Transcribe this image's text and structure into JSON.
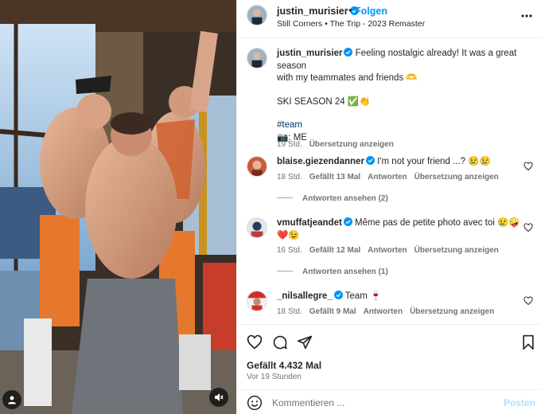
{
  "post": {
    "author": "justin_murisier",
    "separator": "•",
    "follow_label": "Folgen",
    "music": "Still Corners • The Trip - 2023 Remaster",
    "caption_lines": [
      "Feeling nostalgic already! It was a great season",
      "with my teammates and friends 🫶",
      "SKI SEASON 24 ✅👏",
      "#team",
      "📷: ME"
    ],
    "caption_time": "19 Std.",
    "translate_label": "Übersetzung anzeigen"
  },
  "comments": [
    {
      "username": "blaise.giezendanner",
      "text": "I'm not your friend ...? 😢😢",
      "time": "18 Std.",
      "likes": "Gefällt 13 Mal",
      "reply_label": "Antworten",
      "translate_label": "Übersetzung anzeigen",
      "view_replies": "Antworten ansehen (2)"
    },
    {
      "username": "vmuffatjeandet",
      "text": "Même pas de petite photo avec toi 😢🤪",
      "text2": "❤️😉",
      "time": "16 Std.",
      "likes": "Gefällt 12 Mal",
      "reply_label": "Antworten",
      "translate_label": "Übersetzung anzeigen",
      "view_replies": "Antworten ansehen (1)"
    },
    {
      "username": "_nilsallegre_",
      "text": "Team 🍷",
      "time": "18 Std.",
      "likes": "Gefällt 9 Mal",
      "reply_label": "Antworten",
      "translate_label": "Übersetzung anzeigen"
    }
  ],
  "footer": {
    "likes": "Gefällt 4.432 Mal",
    "time": "Vor 19 Stunden",
    "comment_placeholder": "Kommentieren ...",
    "post_label": "Posten"
  },
  "icons": {
    "verified": "verified-badge-icon",
    "more": "more-options-icon",
    "heart": "heart-icon",
    "comment": "comment-icon",
    "share": "share-icon",
    "save": "bookmark-icon",
    "emoji": "emoji-icon",
    "user_tags": "user-tag-icon",
    "audio": "audio-muted-icon"
  },
  "colors": {
    "accent": "#0095f6",
    "verified": "#0095f6",
    "muted_text": "#737373",
    "post_disabled": "#b2dffc"
  }
}
